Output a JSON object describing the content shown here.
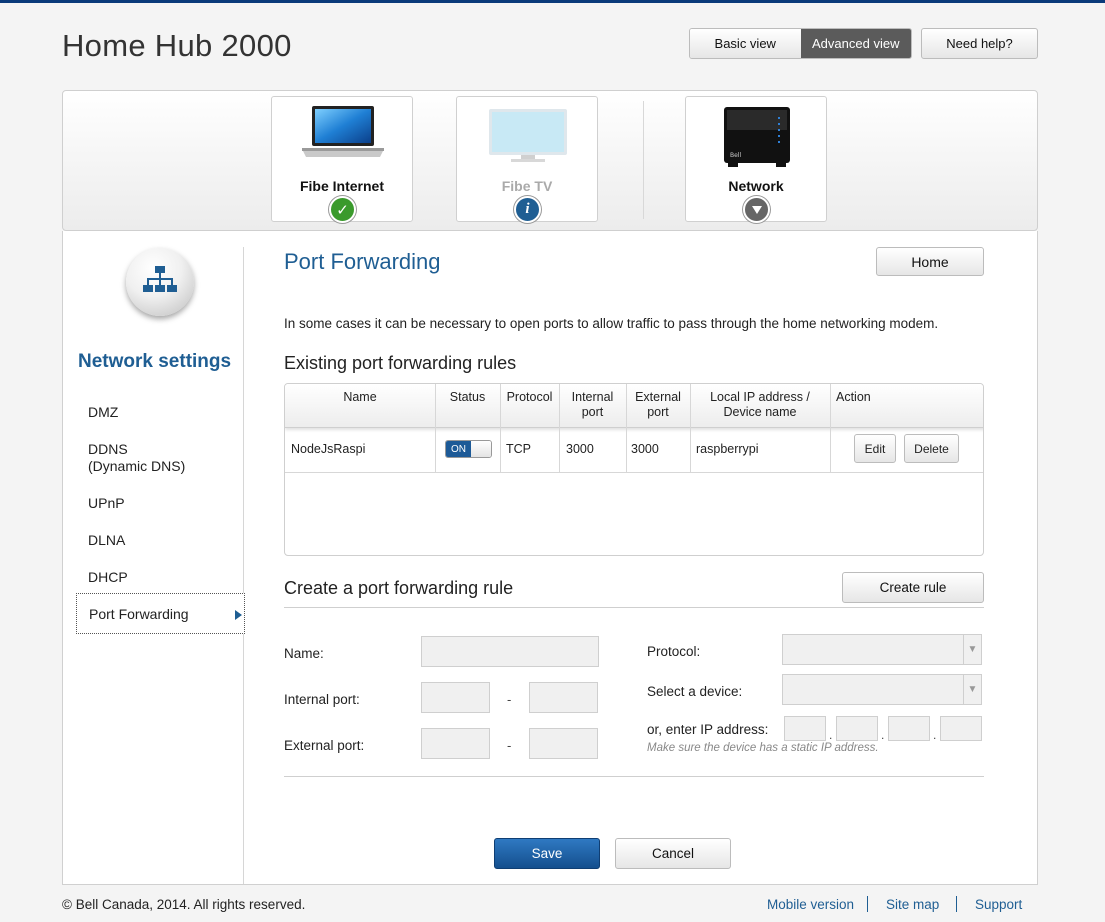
{
  "header": {
    "title": "Home Hub 2000",
    "view_basic": "Basic view",
    "view_advanced": "Advanced view",
    "help": "Need help?"
  },
  "devices": [
    {
      "label": "Fibe Internet",
      "icon": "laptop-icon",
      "status": "check"
    },
    {
      "label": "Fibe TV",
      "icon": "tv-icon",
      "status": "info"
    },
    {
      "label": "Network",
      "icon": "router-icon",
      "status": "chevron-down"
    }
  ],
  "sidebar": {
    "title": "Network settings",
    "items": [
      {
        "label": "DMZ"
      },
      {
        "label": "DDNS"
      },
      {
        "label": "(Dynamic DNS)"
      },
      {
        "label": "UPnP"
      },
      {
        "label": "DLNA"
      },
      {
        "label": "DHCP"
      },
      {
        "label": "Port Forwarding"
      }
    ]
  },
  "main": {
    "title": "Port Forwarding",
    "home_button": "Home",
    "intro": "In some cases it can be necessary to open ports to allow traffic to pass through the home networking modem.",
    "existing_heading": "Existing port forwarding rules",
    "create_heading": "Create a port forwarding rule",
    "create_button": "Create rule",
    "columns": {
      "name": "Name",
      "status": "Status",
      "protocol": "Protocol",
      "internal_1": "Internal",
      "internal_2": "port",
      "external_1": "External",
      "external_2": "port",
      "local_1": "Local IP address /",
      "local_2": "Device name",
      "action": "Action"
    },
    "rules": [
      {
        "name": "NodeJsRaspi",
        "status": "ON",
        "protocol": "TCP",
        "internal_port": "3000",
        "external_port": "3000",
        "device": "raspberrypi",
        "edit": "Edit",
        "delete": "Delete"
      }
    ],
    "form": {
      "name_label": "Name:",
      "internal_label": "Internal port:",
      "external_label": "External port:",
      "dash": "-",
      "protocol_label": "Protocol:",
      "device_label": "Select a device:",
      "ip_label": "or, enter IP address:",
      "ip_hint": "Make sure the device has a static IP address.",
      "ip_dot": "."
    },
    "save": "Save",
    "cancel": "Cancel"
  },
  "footer": {
    "copyright": "© Bell Canada, 2014. All rights reserved.",
    "links": [
      "Mobile version",
      "Site map",
      "Support"
    ]
  },
  "colors": {
    "accent": "#1f5e93",
    "save_button": "#1d5a97",
    "status_ok": "#3a9a2c",
    "status_info": "#1f5e93",
    "status_neutral": "#666666"
  }
}
